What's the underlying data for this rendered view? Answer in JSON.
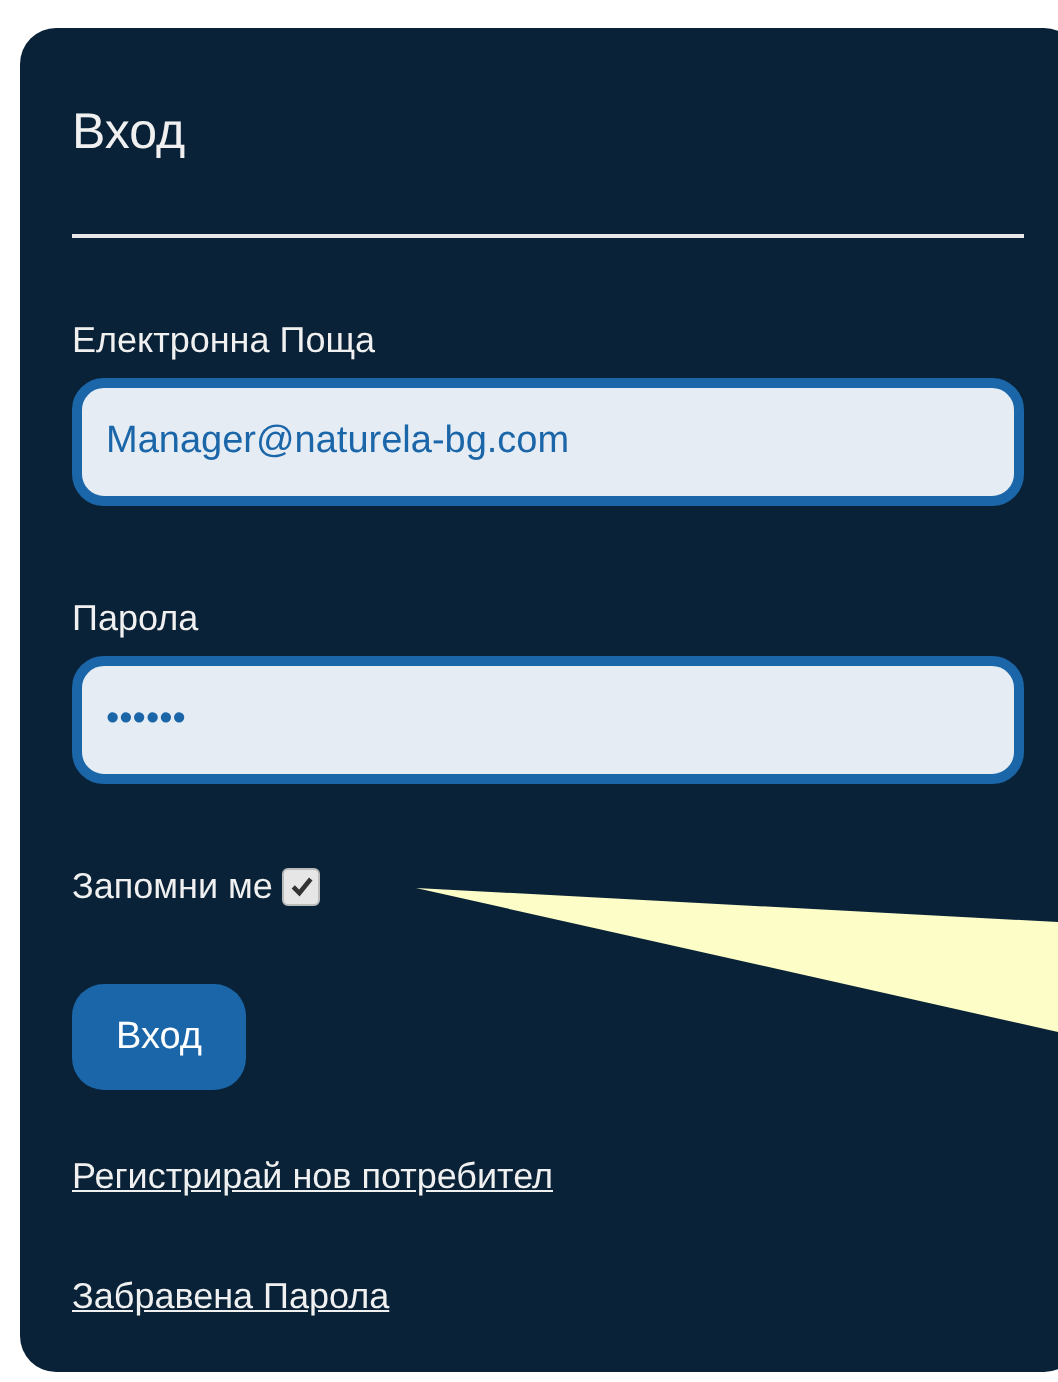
{
  "title": "Вход",
  "fields": [
    {
      "label": "Електронна Поща",
      "value": "Manager@naturela-bg.com"
    },
    {
      "label": "Парола",
      "value": "••••••"
    }
  ],
  "remember": {
    "label": "Запомни ме",
    "checked": true
  },
  "submit": "Вход",
  "links": [
    "Регистрирай нов потребител",
    "Забравена Парола"
  ]
}
